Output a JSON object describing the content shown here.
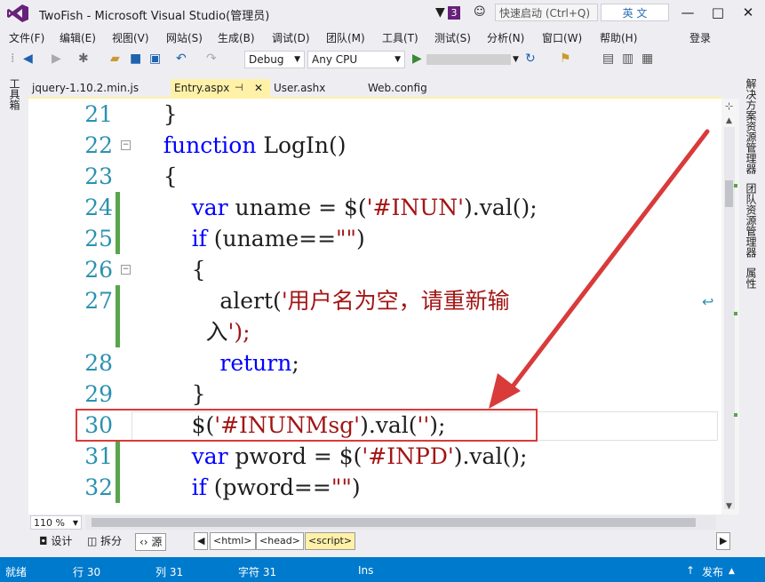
{
  "window": {
    "title": "TwoFish - Microsoft Visual Studio(管理员)",
    "notification_count": "3",
    "quick_launch_placeholder": "快速启动 (Ctrl+Q)",
    "ime_label": "英 文",
    "minimize": "—",
    "restore": "□",
    "close": "✕"
  },
  "menu": {
    "items": [
      "文件(F)",
      "编辑(E)",
      "视图(V)",
      "网站(S)",
      "生成(B)",
      "调试(D)",
      "团队(M)",
      "工具(T)",
      "测试(S)",
      "分析(N)",
      "窗口(W)",
      "帮助(H)"
    ],
    "login": "登录"
  },
  "toolbar": {
    "config": "Debug",
    "platform": "Any CPU"
  },
  "left_strip": {
    "label": "工具箱"
  },
  "right_strip": {
    "labels": [
      "解决方案资源管理器",
      "团队资源管理器",
      "属性"
    ]
  },
  "tabs": {
    "items": [
      "jquery-1.10.2.min.js",
      "Entry.aspx",
      "User.ashx",
      "Web.config"
    ],
    "pin": "⊣",
    "close": "✕"
  },
  "editor": {
    "lines": [
      {
        "num": "21",
        "code": "    }"
      },
      {
        "num": "22",
        "code": "    function LogIn()"
      },
      {
        "num": "23",
        "code": "    {"
      },
      {
        "num": "24",
        "code": "        var uname = $('#INUN').val();"
      },
      {
        "num": "25",
        "code": "        if (uname==\"\")"
      },
      {
        "num": "26",
        "code": "        {"
      },
      {
        "num": "27",
        "code": "            alert('用户名为空，请重新输"
      },
      {
        "num": "",
        "code": "          入');"
      },
      {
        "num": "28",
        "code": "            return;"
      },
      {
        "num": "29",
        "code": "        }"
      },
      {
        "num": "30",
        "code": "        $('#INUNMsg').val('');"
      },
      {
        "num": "31",
        "code": "        var pword = $('#INPD').val();"
      },
      {
        "num": "32",
        "code": "        if (pword==\"\")"
      }
    ]
  },
  "zoom": "110 %",
  "view_buttons": {
    "design": "设计",
    "split": "拆分",
    "source": "源"
  },
  "breadcrumbs": [
    "<html>",
    "<head>",
    "<script>"
  ],
  "status": {
    "ready": "就绪",
    "line": "行 30",
    "col": "列 31",
    "char": "字符 31",
    "ins": "Ins",
    "publish": "发布"
  },
  "colors": {
    "accent": "#007acc",
    "active_tab": "#fff1a8",
    "keyword": "#0000ff",
    "string": "#a31515",
    "line_number": "#2b91af",
    "change_marker": "#57a64a",
    "annotation": "#d93a3a"
  }
}
